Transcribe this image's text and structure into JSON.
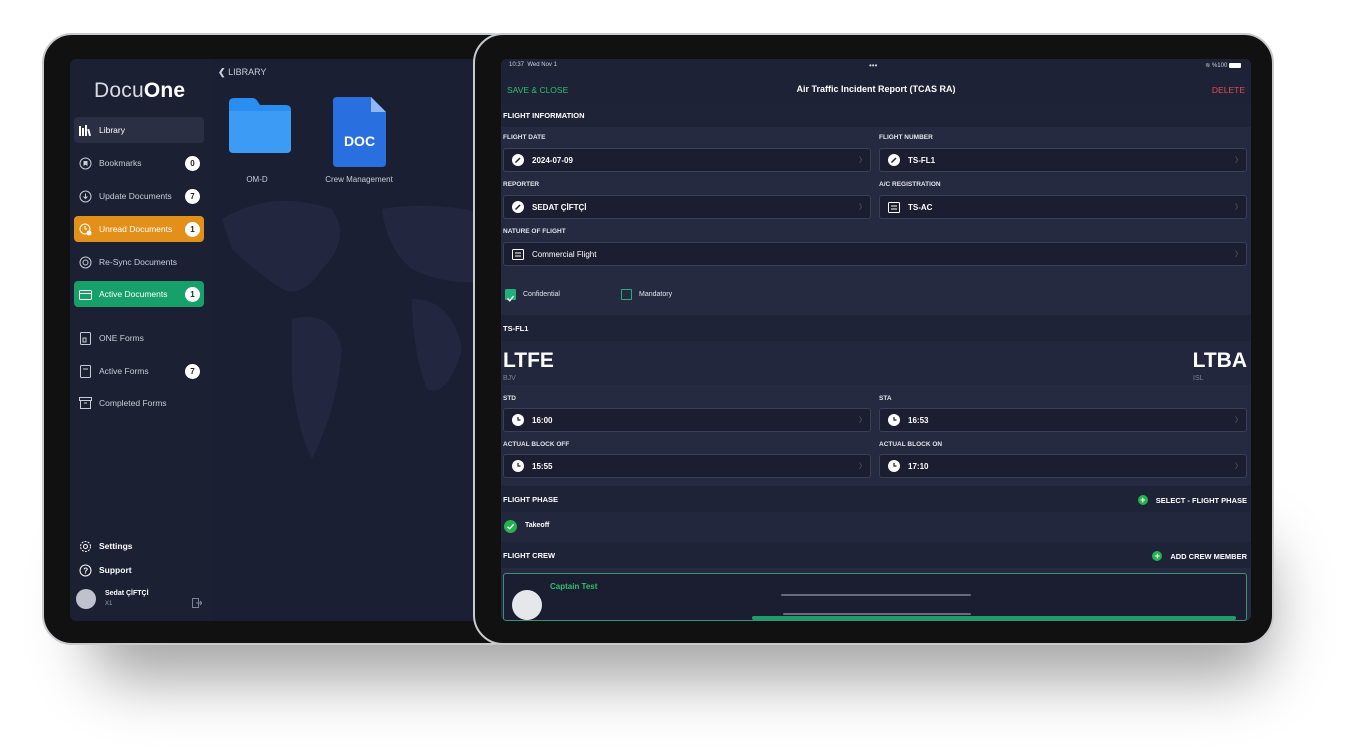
{
  "back_tablet": {
    "brand": {
      "prefix": "Docu",
      "suffix": "One"
    },
    "nav": [
      {
        "label": "Library",
        "icon": "library-icon"
      },
      {
        "label": "Bookmarks",
        "icon": "bookmark-icon",
        "badge": "0"
      },
      {
        "label": "Update Documents",
        "icon": "download-icon",
        "badge": "7"
      },
      {
        "label": "Unread Documents",
        "icon": "unread-icon",
        "badge": "1"
      },
      {
        "label": "Re-Sync Documents",
        "icon": "resync-icon"
      },
      {
        "label": "Active Documents",
        "icon": "folder-icon",
        "badge": "1"
      },
      {
        "label": "ONE Forms",
        "icon": "forms-icon"
      },
      {
        "label": "Active Forms",
        "icon": "active-forms-icon",
        "badge": "7"
      },
      {
        "label": "Completed Forms",
        "icon": "archive-icon"
      }
    ],
    "settings_label": "Settings",
    "support_label": "Support",
    "user": {
      "name": "Sedat ÇİFTÇİ",
      "sub": "X1"
    },
    "breadcrumb": "LIBRARY",
    "files": [
      {
        "label": "OM-D",
        "type": "folder"
      },
      {
        "label": "Crew Management",
        "type": "doc",
        "badge_text": "DOC"
      }
    ],
    "colors": {
      "orange": "#e3901b",
      "green": "#18a06a"
    }
  },
  "front_tablet": {
    "status": {
      "time": "10:37",
      "date": "Wed Nov 1",
      "battery": "%100"
    },
    "save_close": "SAVE & CLOSE",
    "title": "Air Traffic Incident Report (TCAS RA)",
    "delete": "DELETE",
    "flight_info_header": "FLIGHT INFORMATION",
    "fields": {
      "flight_date": {
        "label": "FLIGHT DATE",
        "value": "2024-07-09"
      },
      "flight_number": {
        "label": "FLIGHT NUMBER",
        "value": "TS-FL1"
      },
      "reporter": {
        "label": "REPORTER",
        "value": "SEDAT ÇİFTÇİ"
      },
      "ac_registration": {
        "label": "A/C REGISTRATION",
        "value": "TS-AC"
      },
      "nature_of_flight": {
        "label": "NATURE OF FLIGHT",
        "value": "Commercial Flight"
      }
    },
    "checkboxes": [
      {
        "label": "Confidential",
        "checked": true
      },
      {
        "label": "Mandatory",
        "checked": false
      }
    ],
    "route_header": "TS-FL1",
    "origin": {
      "code": "LTFE",
      "sub": "BJV"
    },
    "destination": {
      "code": "LTBA",
      "sub": "ISL"
    },
    "times": {
      "std": {
        "label": "STD",
        "value": "16:00"
      },
      "sta": {
        "label": "STA",
        "value": "16:53"
      },
      "block_off": {
        "label": "ACTUAL BLOCK OFF",
        "value": "15:55"
      },
      "block_on": {
        "label": "ACTUAL BLOCK ON",
        "value": "17:10"
      }
    },
    "flight_phase": {
      "header": "FLIGHT PHASE",
      "action": "SELECT - FLIGHT PHASE",
      "selected": "Takeoff"
    },
    "flight_crew": {
      "header": "FLIGHT CREW",
      "action": "ADD CREW MEMBER",
      "member": "Captain Test"
    },
    "colors": {
      "green": "#2fbf6c",
      "red": "#e24b4b",
      "accent": "#22b07a"
    }
  }
}
